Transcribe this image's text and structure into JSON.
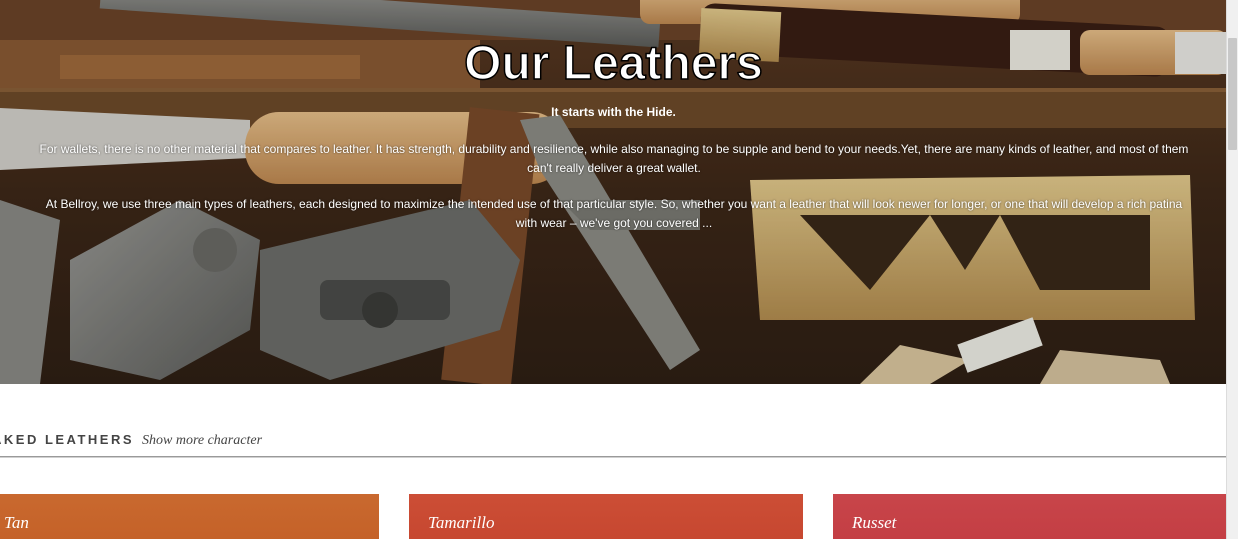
{
  "hero": {
    "title": "Our Leathers",
    "subtitle": "It starts with the Hide.",
    "paragraph1": "For wallets, there is no other material that compares to leather. It has strength, durability and resilience, while also managing to be supple and bend to your needs.Yet, there are many kinds of leather, and most of them can't really deliver a great wallet.",
    "paragraph2": "At Bellroy, we use three main types of leathers, each designed to maximize the intended use of that particular style. So, whether you want a leather that will look newer for longer, or one that will develop a rich patina with wear – we've got you covered ..."
  },
  "section": {
    "title": "AKED LEATHERS",
    "tagline": "Show more character"
  },
  "swatches": [
    {
      "label": "Tan",
      "color": "#c9692f"
    },
    {
      "label": "Tamarillo",
      "color": "#cc4e36"
    },
    {
      "label": "Russet",
      "color": "#c8454a"
    }
  ],
  "colors": {
    "hero_wood": "#3b2a1c",
    "text_dark": "#444444",
    "scrollbar_track": "#f0f0f0",
    "scrollbar_thumb": "#c8c8c8"
  }
}
